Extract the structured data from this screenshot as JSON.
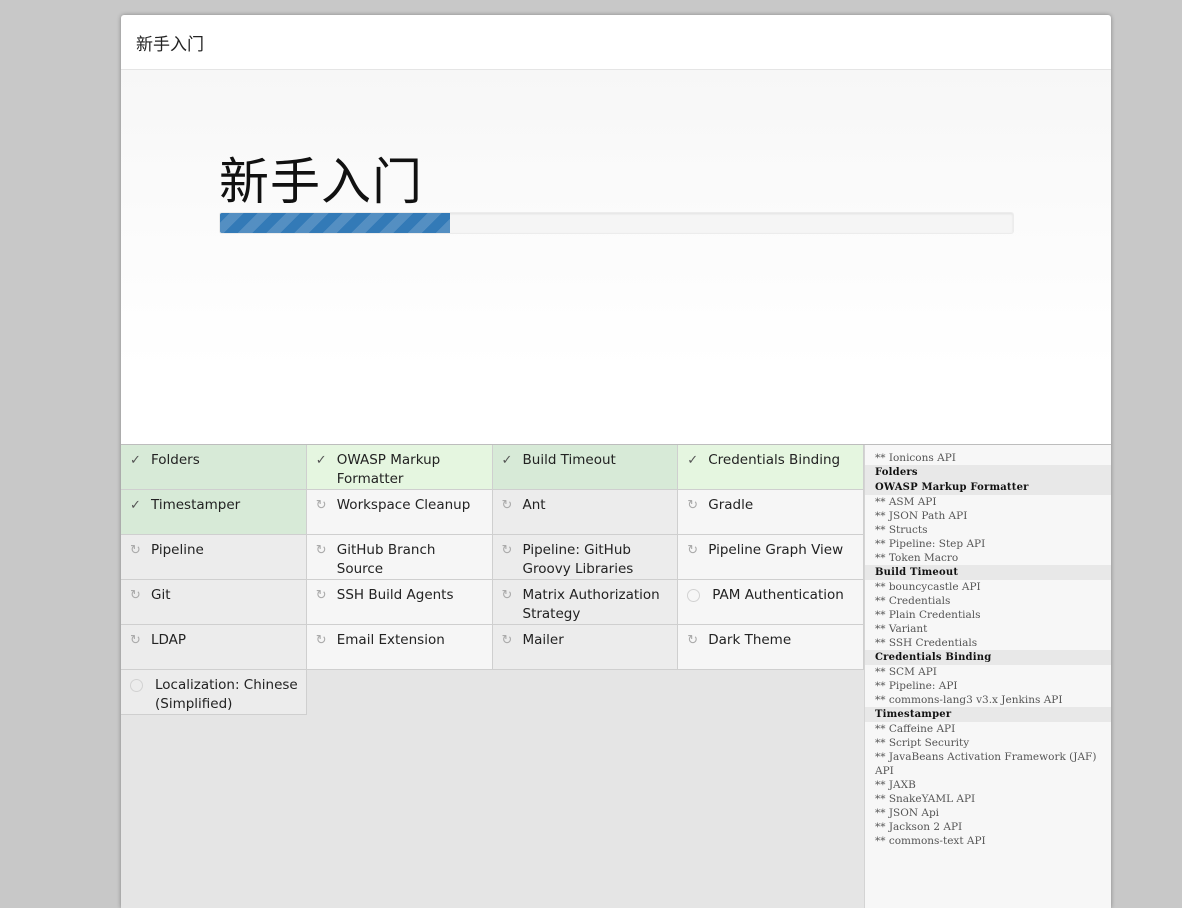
{
  "header": {
    "title": "新手入门"
  },
  "hero": {
    "heading": "新手入门",
    "progress": 0.29
  },
  "plugins": [
    {
      "label": "Folders",
      "status": "success"
    },
    {
      "label": "OWASP Markup Formatter",
      "status": "success"
    },
    {
      "label": "Build Timeout",
      "status": "success"
    },
    {
      "label": "Credentials Binding",
      "status": "success"
    },
    {
      "label": "Timestamper",
      "status": "success"
    },
    {
      "label": "Workspace Cleanup",
      "status": "pending"
    },
    {
      "label": "Ant",
      "status": "pending"
    },
    {
      "label": "Gradle",
      "status": "pending"
    },
    {
      "label": "Pipeline",
      "status": "pending"
    },
    {
      "label": "GitHub Branch Source",
      "status": "pending"
    },
    {
      "label": "Pipeline: GitHub Groovy Libraries",
      "status": "pending"
    },
    {
      "label": "Pipeline Graph View",
      "status": "pending"
    },
    {
      "label": "Git",
      "status": "pending"
    },
    {
      "label": "SSH Build Agents",
      "status": "pending"
    },
    {
      "label": "Matrix Authorization Strategy",
      "status": "pending"
    },
    {
      "label": "PAM Authentication",
      "status": "none"
    },
    {
      "label": "LDAP",
      "status": "pending"
    },
    {
      "label": "Email Extension",
      "status": "pending"
    },
    {
      "label": "Mailer",
      "status": "pending"
    },
    {
      "label": "Dark Theme",
      "status": "pending"
    },
    {
      "label": "Localization: Chinese (Simplified)",
      "status": "none"
    }
  ],
  "icons": {
    "success": "check-icon",
    "pending": "refresh-icon",
    "none": "empty-circle-icon"
  },
  "log": [
    {
      "text": "** Ionicons API",
      "head": false
    },
    {
      "text": "Folders",
      "head": true
    },
    {
      "text": "OWASP Markup Formatter",
      "head": true
    },
    {
      "text": "** ASM API",
      "head": false
    },
    {
      "text": "** JSON Path API",
      "head": false
    },
    {
      "text": "** Structs",
      "head": false
    },
    {
      "text": "** Pipeline: Step API",
      "head": false
    },
    {
      "text": "** Token Macro",
      "head": false
    },
    {
      "text": "Build Timeout",
      "head": true
    },
    {
      "text": "** bouncycastle API",
      "head": false
    },
    {
      "text": "** Credentials",
      "head": false
    },
    {
      "text": "** Plain Credentials",
      "head": false
    },
    {
      "text": "** Variant",
      "head": false
    },
    {
      "text": "** SSH Credentials",
      "head": false
    },
    {
      "text": "Credentials Binding",
      "head": true
    },
    {
      "text": "** SCM API",
      "head": false
    },
    {
      "text": "** Pipeline: API",
      "head": false
    },
    {
      "text": "** commons-lang3 v3.x Jenkins API",
      "head": false
    },
    {
      "text": "Timestamper",
      "head": true
    },
    {
      "text": "** Caffeine API",
      "head": false
    },
    {
      "text": "** Script Security",
      "head": false
    },
    {
      "text": "** JavaBeans Activation Framework (JAF) API",
      "head": false
    },
    {
      "text": "** JAXB",
      "head": false
    },
    {
      "text": "** SnakeYAML API",
      "head": false
    },
    {
      "text": "** JSON Api",
      "head": false
    },
    {
      "text": "** Jackson 2 API",
      "head": false
    },
    {
      "text": "** commons-text API",
      "head": false
    }
  ]
}
